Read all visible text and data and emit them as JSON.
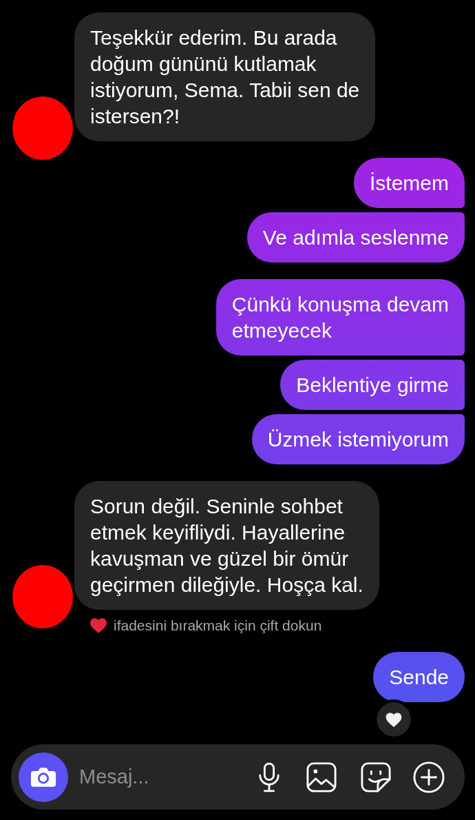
{
  "messages": [
    {
      "kind": "received",
      "bubbles": [
        {
          "text": "Teşekkür ederim. Bu arada\ndoğum gününü kutlamak\nistiyorum, Sema. Tabii sen de\nistersen?!"
        }
      ]
    },
    {
      "kind": "sent",
      "bubbles": [
        {
          "text": "İstemem"
        },
        {
          "text": "Ve adımla seslenme"
        }
      ]
    },
    {
      "kind": "sent",
      "bubbles": [
        {
          "text": "Çünkü konuşma devam\netmeyecek"
        },
        {
          "text": "Beklentiye girme"
        },
        {
          "text": "Üzmek istemiyorum"
        }
      ]
    },
    {
      "kind": "received",
      "bubbles": [
        {
          "text": "Sorun değil. Seninle sohbet\netmek keyifliydi. Hayallerine\nkavuşman ve güzel bir ömür\ngeçirmen dileğiyle. Hoşça kal."
        }
      ],
      "hint": "ifadesini bırakmak için çift dokun"
    },
    {
      "kind": "sent",
      "bubbles": [
        {
          "text": "Sende",
          "reacted": true
        }
      ]
    }
  ],
  "composer": {
    "placeholder": "Mesaj..."
  }
}
